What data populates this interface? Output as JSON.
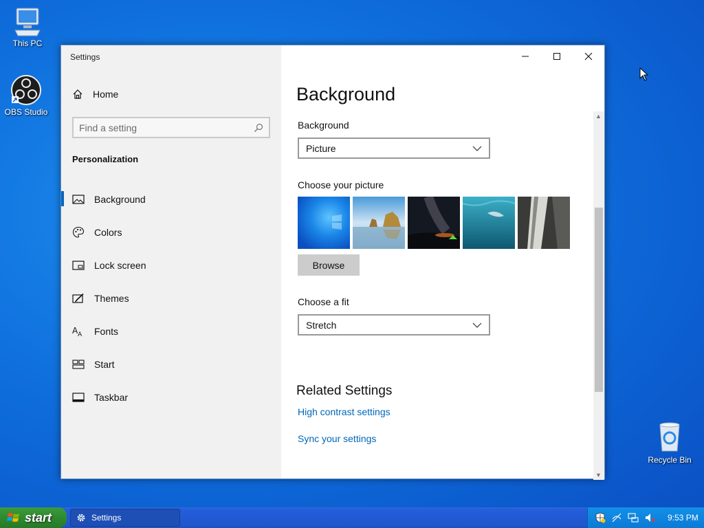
{
  "desktop": {
    "icons": [
      {
        "label": "This PC",
        "icon": "computer-icon"
      },
      {
        "label": "OBS Studio",
        "icon": "obs-icon"
      },
      {
        "label": "Recycle Bin",
        "icon": "recycle-bin-icon"
      }
    ]
  },
  "window": {
    "title": "Settings",
    "home_label": "Home",
    "search_placeholder": "Find a setting",
    "section": "Personalization",
    "nav": [
      {
        "label": "Background",
        "icon": "picture-icon",
        "active": true
      },
      {
        "label": "Colors",
        "icon": "palette-icon",
        "active": false
      },
      {
        "label": "Lock screen",
        "icon": "lock-screen-icon",
        "active": false
      },
      {
        "label": "Themes",
        "icon": "brush-icon",
        "active": false
      },
      {
        "label": "Fonts",
        "icon": "font-icon",
        "active": false
      },
      {
        "label": "Start",
        "icon": "start-icon",
        "active": false
      },
      {
        "label": "Taskbar",
        "icon": "taskbar-icon",
        "active": false
      }
    ]
  },
  "main": {
    "title": "Background",
    "background_label": "Background",
    "background_value": "Picture",
    "choose_picture_label": "Choose your picture",
    "browse_label": "Browse",
    "fit_label": "Choose a fit",
    "fit_value": "Stretch",
    "related_title": "Related Settings",
    "links": [
      "High contrast settings",
      "Sync your settings"
    ]
  },
  "taskbar": {
    "start_label": "start",
    "task_label": "Settings",
    "clock": "9:53 PM"
  },
  "colors": {
    "accent": "#0067c0",
    "link": "#0067b8",
    "taskbar": "#245edb",
    "start": "#2f8a2f"
  }
}
